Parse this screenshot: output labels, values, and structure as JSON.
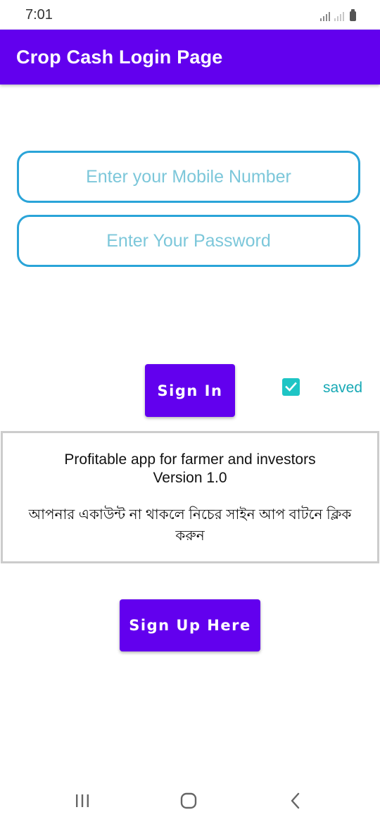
{
  "status_bar": {
    "time": "7:01"
  },
  "app_bar": {
    "title": "Crop Cash Login Page",
    "color": "#6200ee"
  },
  "form": {
    "mobile": {
      "placeholder": "Enter your Mobile Number",
      "value": ""
    },
    "password": {
      "placeholder": "Enter Your Password",
      "value": ""
    },
    "sign_in_label": "Sign In",
    "saved_checkbox": {
      "checked": true,
      "label": "saved"
    }
  },
  "info": {
    "line1": "Profitable app for farmer and investors",
    "line2": "Version 1.0",
    "bengali_note": "আপনার একাউন্ট না থাকলে নিচের সাইন আপ বাটনে ক্লিক করুন"
  },
  "sign_up_label": "Sign Up Here",
  "nav_bar": {
    "icons": [
      "recent-apps-icon",
      "home-icon",
      "back-icon"
    ]
  },
  "colors": {
    "accent": "#6200ee",
    "input_border": "#2aa4d8",
    "placeholder": "#7cc7da",
    "checkbox": "#1ec5c5"
  }
}
